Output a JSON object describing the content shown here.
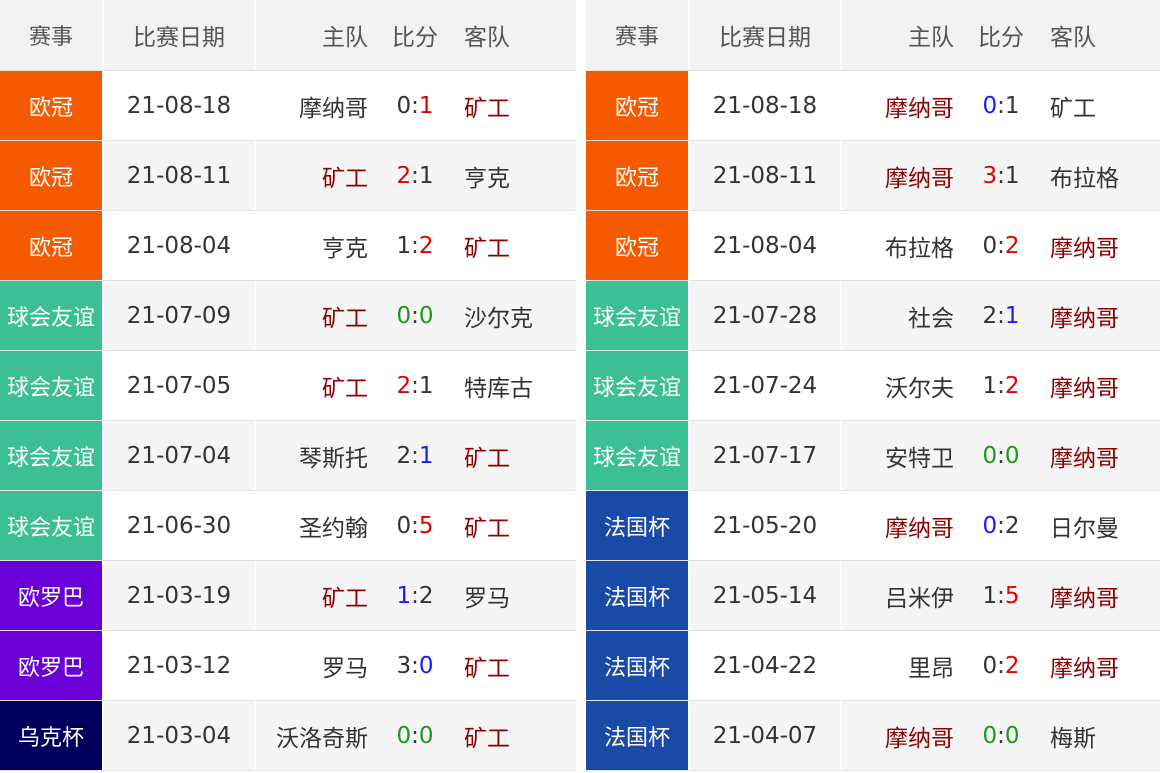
{
  "colors": {
    "ucl": "#f55a00",
    "friendly": "#3cbf95",
    "uel": "#6a00d8",
    "ukr_cup": "#00005c",
    "fr_cup": "#1a4aa8",
    "team_highlight": "#8b0000",
    "score_red": "#e00000",
    "score_blue": "#1a1aff",
    "score_green": "#1a9a1a"
  },
  "headers": {
    "competition": "赛事",
    "date": "比赛日期",
    "home": "主队",
    "score": "比分",
    "away": "客队"
  },
  "left": [
    {
      "comp": "欧冠",
      "comp_color": "ucl",
      "date": "21-08-18",
      "home": "摩纳哥",
      "home_hl": false,
      "s1": "0",
      "s1c": "sd",
      "s2": "1",
      "s2c": "sr",
      "away": "矿工",
      "away_hl": true
    },
    {
      "comp": "欧冠",
      "comp_color": "ucl",
      "date": "21-08-11",
      "home": "矿工",
      "home_hl": true,
      "s1": "2",
      "s1c": "sr",
      "s2": "1",
      "s2c": "sd",
      "away": "亨克",
      "away_hl": false
    },
    {
      "comp": "欧冠",
      "comp_color": "ucl",
      "date": "21-08-04",
      "home": "亨克",
      "home_hl": false,
      "s1": "1",
      "s1c": "sd",
      "s2": "2",
      "s2c": "sr",
      "away": "矿工",
      "away_hl": true
    },
    {
      "comp": "球会友谊",
      "comp_color": "friendly",
      "date": "21-07-09",
      "home": "矿工",
      "home_hl": true,
      "s1": "0",
      "s1c": "sg",
      "s2": "0",
      "s2c": "sg",
      "away": "沙尔克",
      "away_hl": false
    },
    {
      "comp": "球会友谊",
      "comp_color": "friendly",
      "date": "21-07-05",
      "home": "矿工",
      "home_hl": true,
      "s1": "2",
      "s1c": "sr",
      "s2": "1",
      "s2c": "sd",
      "away": "特库古",
      "away_hl": false
    },
    {
      "comp": "球会友谊",
      "comp_color": "friendly",
      "date": "21-07-04",
      "home": "琴斯托",
      "home_hl": false,
      "s1": "2",
      "s1c": "sd",
      "s2": "1",
      "s2c": "sb",
      "away": "矿工",
      "away_hl": true
    },
    {
      "comp": "球会友谊",
      "comp_color": "friendly",
      "date": "21-06-30",
      "home": "圣约翰",
      "home_hl": false,
      "s1": "0",
      "s1c": "sd",
      "s2": "5",
      "s2c": "sr",
      "away": "矿工",
      "away_hl": true
    },
    {
      "comp": "欧罗巴",
      "comp_color": "uel",
      "date": "21-03-19",
      "home": "矿工",
      "home_hl": true,
      "s1": "1",
      "s1c": "sb",
      "s2": "2",
      "s2c": "sd",
      "away": "罗马",
      "away_hl": false
    },
    {
      "comp": "欧罗巴",
      "comp_color": "uel",
      "date": "21-03-12",
      "home": "罗马",
      "home_hl": false,
      "s1": "3",
      "s1c": "sd",
      "s2": "0",
      "s2c": "sb",
      "away": "矿工",
      "away_hl": true
    },
    {
      "comp": "乌克杯",
      "comp_color": "ukr_cup",
      "date": "21-03-04",
      "home": "沃洛奇斯",
      "home_hl": false,
      "s1": "0",
      "s1c": "sg",
      "s2": "0",
      "s2c": "sg",
      "away": "矿工",
      "away_hl": true
    }
  ],
  "right": [
    {
      "comp": "欧冠",
      "comp_color": "ucl",
      "date": "21-08-18",
      "home": "摩纳哥",
      "home_hl": true,
      "s1": "0",
      "s1c": "sb",
      "s2": "1",
      "s2c": "sd",
      "away": "矿工",
      "away_hl": false
    },
    {
      "comp": "欧冠",
      "comp_color": "ucl",
      "date": "21-08-11",
      "home": "摩纳哥",
      "home_hl": true,
      "s1": "3",
      "s1c": "sr",
      "s2": "1",
      "s2c": "sd",
      "away": "布拉格",
      "away_hl": false
    },
    {
      "comp": "欧冠",
      "comp_color": "ucl",
      "date": "21-08-04",
      "home": "布拉格",
      "home_hl": false,
      "s1": "0",
      "s1c": "sd",
      "s2": "2",
      "s2c": "sr",
      "away": "摩纳哥",
      "away_hl": true
    },
    {
      "comp": "球会友谊",
      "comp_color": "friendly",
      "date": "21-07-28",
      "home": "社会",
      "home_hl": false,
      "s1": "2",
      "s1c": "sd",
      "s2": "1",
      "s2c": "sb",
      "away": "摩纳哥",
      "away_hl": true
    },
    {
      "comp": "球会友谊",
      "comp_color": "friendly",
      "date": "21-07-24",
      "home": "沃尔夫",
      "home_hl": false,
      "s1": "1",
      "s1c": "sd",
      "s2": "2",
      "s2c": "sr",
      "away": "摩纳哥",
      "away_hl": true
    },
    {
      "comp": "球会友谊",
      "comp_color": "friendly",
      "date": "21-07-17",
      "home": "安特卫",
      "home_hl": false,
      "s1": "0",
      "s1c": "sg",
      "s2": "0",
      "s2c": "sg",
      "away": "摩纳哥",
      "away_hl": true
    },
    {
      "comp": "法国杯",
      "comp_color": "fr_cup",
      "date": "21-05-20",
      "home": "摩纳哥",
      "home_hl": true,
      "s1": "0",
      "s1c": "sb",
      "s2": "2",
      "s2c": "sd",
      "away": "日尔曼",
      "away_hl": false
    },
    {
      "comp": "法国杯",
      "comp_color": "fr_cup",
      "date": "21-05-14",
      "home": "吕米伊",
      "home_hl": false,
      "s1": "1",
      "s1c": "sd",
      "s2": "5",
      "s2c": "sr",
      "away": "摩纳哥",
      "away_hl": true
    },
    {
      "comp": "法国杯",
      "comp_color": "fr_cup",
      "date": "21-04-22",
      "home": "里昂",
      "home_hl": false,
      "s1": "0",
      "s1c": "sd",
      "s2": "2",
      "s2c": "sr",
      "away": "摩纳哥",
      "away_hl": true
    },
    {
      "comp": "法国杯",
      "comp_color": "fr_cup",
      "date": "21-04-07",
      "home": "摩纳哥",
      "home_hl": true,
      "s1": "0",
      "s1c": "sg",
      "s2": "0",
      "s2c": "sg",
      "away": "梅斯",
      "away_hl": false
    }
  ]
}
